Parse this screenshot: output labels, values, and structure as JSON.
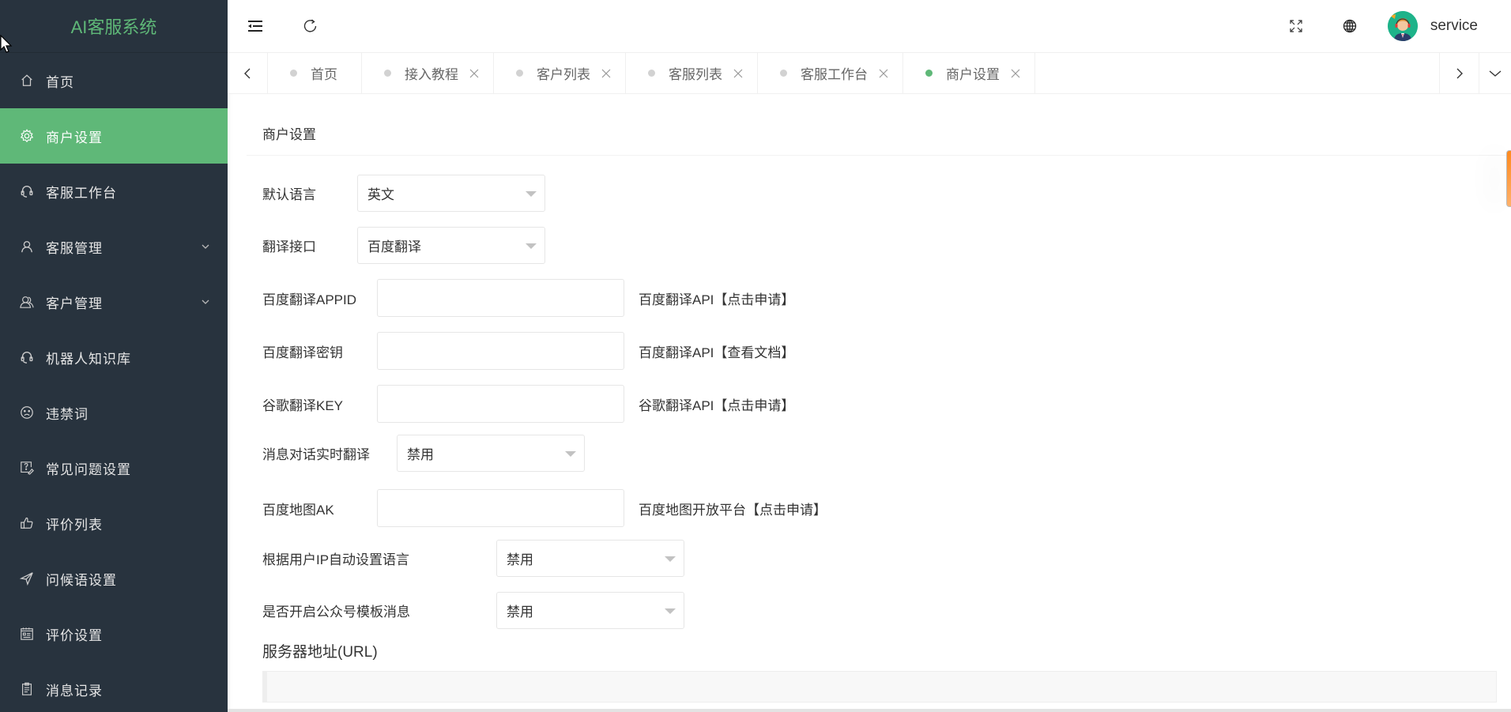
{
  "app": {
    "title": "AI客服系统",
    "accent_color": "#5fb878",
    "sidebar_bg": "#28333e"
  },
  "sidebar": {
    "items": [
      {
        "label": "首页",
        "icon": "home-icon",
        "active": false,
        "has_submenu": false
      },
      {
        "label": "商户设置",
        "icon": "gear-icon",
        "active": true,
        "has_submenu": false
      },
      {
        "label": "客服工作台",
        "icon": "headset-icon",
        "active": false,
        "has_submenu": false
      },
      {
        "label": "客服管理",
        "icon": "user-icon",
        "active": false,
        "has_submenu": true
      },
      {
        "label": "客户管理",
        "icon": "users-icon",
        "active": false,
        "has_submenu": true
      },
      {
        "label": "机器人知识库",
        "icon": "headset-icon",
        "active": false,
        "has_submenu": false
      },
      {
        "label": "违禁词",
        "icon": "sad-face-icon",
        "active": false,
        "has_submenu": false
      },
      {
        "label": "常见问题设置",
        "icon": "question-edit-icon",
        "active": false,
        "has_submenu": false
      },
      {
        "label": "评价列表",
        "icon": "thumbs-up-icon",
        "active": false,
        "has_submenu": false
      },
      {
        "label": "问候语设置",
        "icon": "send-icon",
        "active": false,
        "has_submenu": false
      },
      {
        "label": "评价设置",
        "icon": "calendar-icon",
        "active": false,
        "has_submenu": false
      },
      {
        "label": "消息记录",
        "icon": "clipboard-icon",
        "active": false,
        "has_submenu": false
      }
    ]
  },
  "header": {
    "toggle_icon": "menu-fold-icon",
    "refresh_icon": "refresh-icon",
    "fullscreen_icon": "fullscreen-icon",
    "language_icon": "globe-icon",
    "username": "service"
  },
  "tabs": {
    "items": [
      {
        "label": "首页",
        "closable": false,
        "active": false
      },
      {
        "label": "接入教程",
        "closable": true,
        "active": false
      },
      {
        "label": "客户列表",
        "closable": true,
        "active": false
      },
      {
        "label": "客服列表",
        "closable": true,
        "active": false
      },
      {
        "label": "客服工作台",
        "closable": true,
        "active": false
      },
      {
        "label": "商户设置",
        "closable": true,
        "active": true
      }
    ]
  },
  "page": {
    "card_title": "商户设置",
    "fields": {
      "default_language": {
        "label": "默认语言",
        "value": "英文"
      },
      "translate_api": {
        "label": "翻译接口",
        "value": "百度翻译"
      },
      "baidu_appid": {
        "label": "百度翻译APPID",
        "value": "",
        "hint": "百度翻译API【点击申请】"
      },
      "baidu_secret": {
        "label": "百度翻译密钥",
        "value": "",
        "hint": "百度翻译API【查看文档】"
      },
      "google_key": {
        "label": "谷歌翻译KEY",
        "value": "",
        "hint": "谷歌翻译API【点击申请】"
      },
      "realtime_translate": {
        "label": "消息对话实时翻译",
        "value": "禁用"
      },
      "baidu_map_ak": {
        "label": "百度地图AK",
        "value": "",
        "hint": "百度地图开放平台【点击申请】"
      },
      "ip_auto_language": {
        "label": "根据用户IP自动设置语言",
        "value": "禁用"
      },
      "wechat_template": {
        "label": "是否开启公众号模板消息",
        "value": "禁用"
      },
      "server_url": {
        "label": "服务器地址(URL)",
        "value": ""
      }
    }
  }
}
